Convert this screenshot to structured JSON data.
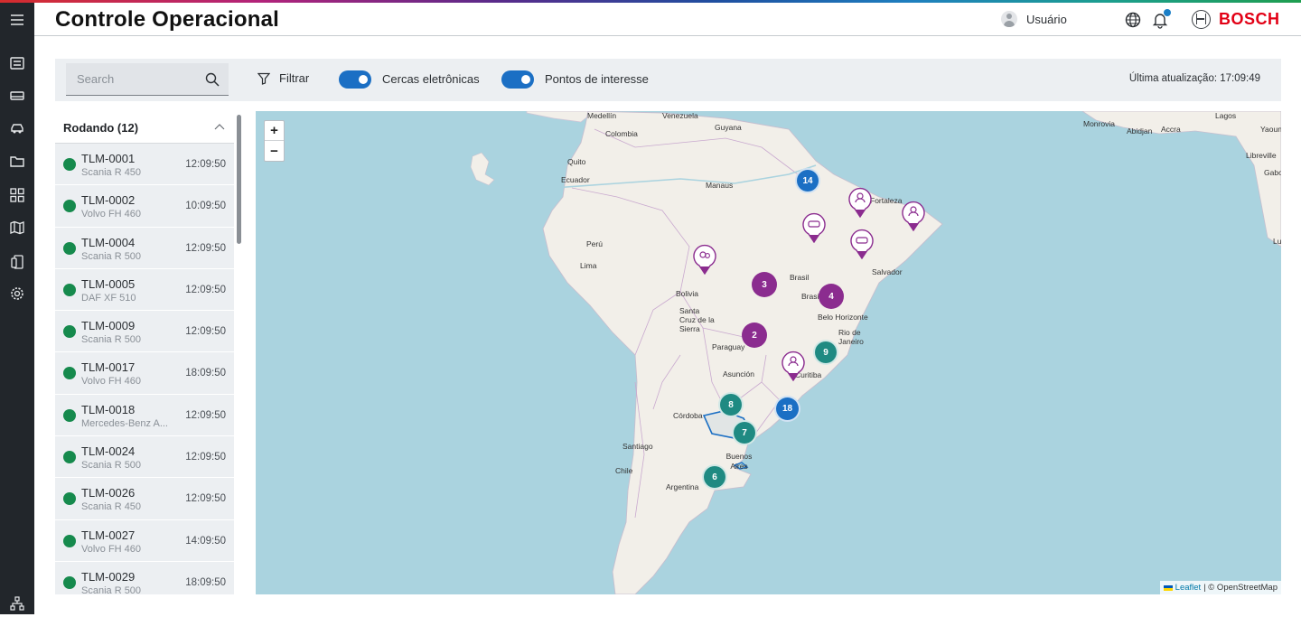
{
  "app": {
    "title": "Controle Operacional",
    "brand": "BOSCH",
    "brand_color": "#e20015",
    "accent_color": "#1b6fc4",
    "online_color": "#168a4d"
  },
  "header": {
    "user_label": "Usuário",
    "icons": [
      "globe-icon",
      "bell-icon"
    ]
  },
  "sidebar": {
    "items": [
      "menu-icon",
      "dashboard-icon",
      "truck-icon",
      "car-icon",
      "folder-icon",
      "grid-icon",
      "map-icon",
      "devices-icon",
      "settings-icon",
      "hierarchy-icon"
    ]
  },
  "toolbar": {
    "search_placeholder": "Search",
    "filter_label": "Filtrar",
    "toggle_fences_label": "Cercas eletrônicas",
    "toggle_fences_on": true,
    "toggle_poi_label": "Pontos de interesse",
    "toggle_poi_on": true,
    "last_update": "Última atualização: 17:09:49"
  },
  "list": {
    "group_label": "Rodando (12)",
    "vehicles": [
      {
        "id": "TLM-0001",
        "model": "Scania R 450",
        "time": "12:09:50",
        "status": "online"
      },
      {
        "id": "TLM-0002",
        "model": "Volvo FH 460",
        "time": "10:09:50",
        "status": "online"
      },
      {
        "id": "TLM-0004",
        "model": "Scania R 500",
        "time": "12:09:50",
        "status": "online"
      },
      {
        "id": "TLM-0005",
        "model": "DAF XF 510",
        "time": "12:09:50",
        "status": "online"
      },
      {
        "id": "TLM-0009",
        "model": "Scania R 500",
        "time": "12:09:50",
        "status": "online"
      },
      {
        "id": "TLM-0017",
        "model": "Volvo FH 460",
        "time": "18:09:50",
        "status": "online"
      },
      {
        "id": "TLM-0018",
        "model": "Mercedes-Benz A...",
        "time": "12:09:50",
        "status": "online"
      },
      {
        "id": "TLM-0024",
        "model": "Scania R 500",
        "time": "12:09:50",
        "status": "online"
      },
      {
        "id": "TLM-0026",
        "model": "Scania R 450",
        "time": "12:09:50",
        "status": "online"
      },
      {
        "id": "TLM-0027",
        "model": "Volvo FH 460",
        "time": "14:09:50",
        "status": "online"
      },
      {
        "id": "TLM-0029",
        "model": "Scania R 500",
        "time": "18:09:50",
        "status": "online"
      }
    ]
  },
  "map": {
    "zoom_in": "+",
    "zoom_out": "−",
    "attribution_leaflet": "Leaflet",
    "attribution_rest": "| © OpenStreetMap",
    "places": [
      "Medellín",
      "Venezuela",
      "Guyana",
      "Colombia",
      "Quito",
      "Ecuador",
      "Manaus",
      "Perú",
      "Lima",
      "Bolivia",
      "Brasil",
      "Brasília",
      "Fortaleza",
      "Salvador",
      "Belo Horizonte",
      "Rio de Janeiro",
      "Santa Cruz de la Sierra",
      "Paraguay",
      "Asunción",
      "Curitiba",
      "Córdoba",
      "Santiago",
      "Chile",
      "Buenos Aires",
      "Argentina",
      "Monrovia",
      "Abidjan",
      "Accra",
      "Lagos",
      "Yaoun",
      "Libreville",
      "Gabo",
      "Lu"
    ],
    "clusters": [
      {
        "count": "14",
        "color": "#1b6fc4"
      },
      {
        "count": "3",
        "color": "#8b2c8f"
      },
      {
        "count": "4",
        "color": "#8b2c8f"
      },
      {
        "count": "2",
        "color": "#8b2c8f"
      },
      {
        "count": "9",
        "color": "#1f8a82"
      },
      {
        "count": "8",
        "color": "#1f8a82"
      },
      {
        "count": "18",
        "color": "#1b6fc4"
      },
      {
        "count": "7",
        "color": "#1f8a82"
      },
      {
        "count": "6",
        "color": "#1f8a82"
      }
    ]
  }
}
